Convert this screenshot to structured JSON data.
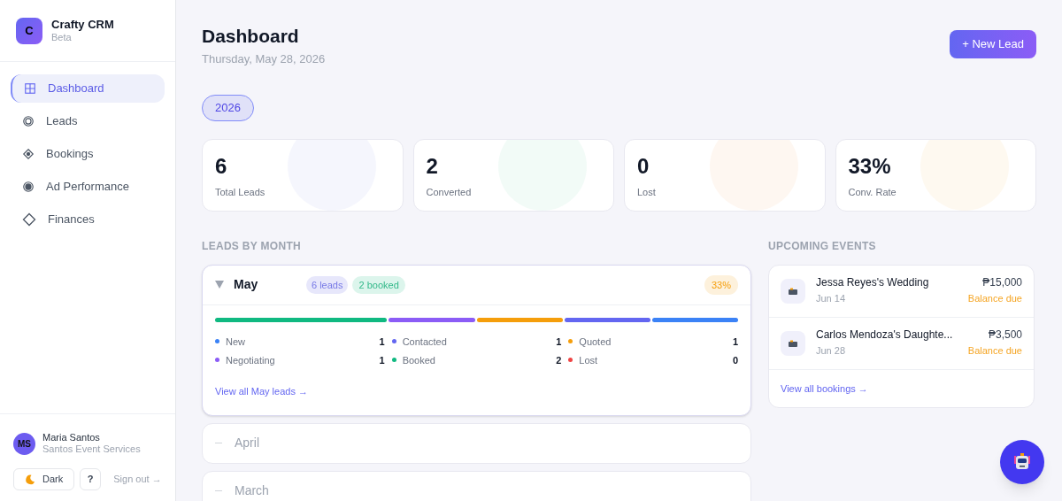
{
  "brand": {
    "logo_letter": "C",
    "name": "Crafty CRM",
    "tag": "Beta"
  },
  "nav": [
    {
      "label": "Dashboard",
      "selected": true
    },
    {
      "label": "Leads",
      "selected": false
    },
    {
      "label": "Bookings",
      "selected": false
    },
    {
      "label": "Ad Performance",
      "selected": false
    },
    {
      "label": "Finances",
      "selected": false
    }
  ],
  "user": {
    "initials": "MS",
    "name": "Maria Santos",
    "company": "Santos Event Services"
  },
  "footer_buttons": {
    "theme": "Dark",
    "help": "?",
    "sign_out": "Sign out →"
  },
  "header": {
    "title": "Dashboard",
    "date": "Thursday, May 28, 2026",
    "new_button": "+ New Lead"
  },
  "year_filter": [
    {
      "label": "2026",
      "selected": true
    }
  ],
  "stats": [
    {
      "value": "6",
      "label": "Total Leads"
    },
    {
      "value": "2",
      "label": "Converted"
    },
    {
      "value": "0",
      "label": "Lost"
    },
    {
      "value": "33%",
      "label": "Conv. Rate"
    }
  ],
  "leads_by_month": {
    "heading": "LEADS BY MONTH",
    "months": [
      {
        "name": "May",
        "expanded": true,
        "leads_badge": "6 leads",
        "booked_badge": "2 booked",
        "rate": "33%",
        "segments": [
          {
            "color": "#10b981"
          },
          {
            "color": "#8b5cf6"
          },
          {
            "color": "#f59e0b"
          },
          {
            "color": "#6366f1"
          },
          {
            "color": "#3b82f6"
          }
        ],
        "statuses": [
          {
            "label": "New",
            "count": "1",
            "color": "#3b82f6"
          },
          {
            "label": "Contacted",
            "count": "1",
            "color": "#6366f1"
          },
          {
            "label": "Quoted",
            "count": "1",
            "color": "#f59e0b"
          },
          {
            "label": "Negotiating",
            "count": "1",
            "color": "#8b5cf6"
          },
          {
            "label": "Booked",
            "count": "2",
            "color": "#10b981"
          },
          {
            "label": "Lost",
            "count": "0",
            "color": "#ef4444"
          }
        ],
        "link": "View all May leads →"
      },
      {
        "name": "April",
        "expanded": false
      },
      {
        "name": "March",
        "expanded": false
      }
    ]
  },
  "upcoming_events": {
    "heading": "UPCOMING EVENTS",
    "events": [
      {
        "title": "Jessa Reyes's Wedding",
        "date": "Jun 14",
        "amount": "₱15,000",
        "status": "Balance due"
      },
      {
        "title": "Carlos Mendoza's Daughte...",
        "date": "Jun 28",
        "amount": "₱3,500",
        "status": "Balance due"
      }
    ],
    "link": "View all bookings →"
  }
}
